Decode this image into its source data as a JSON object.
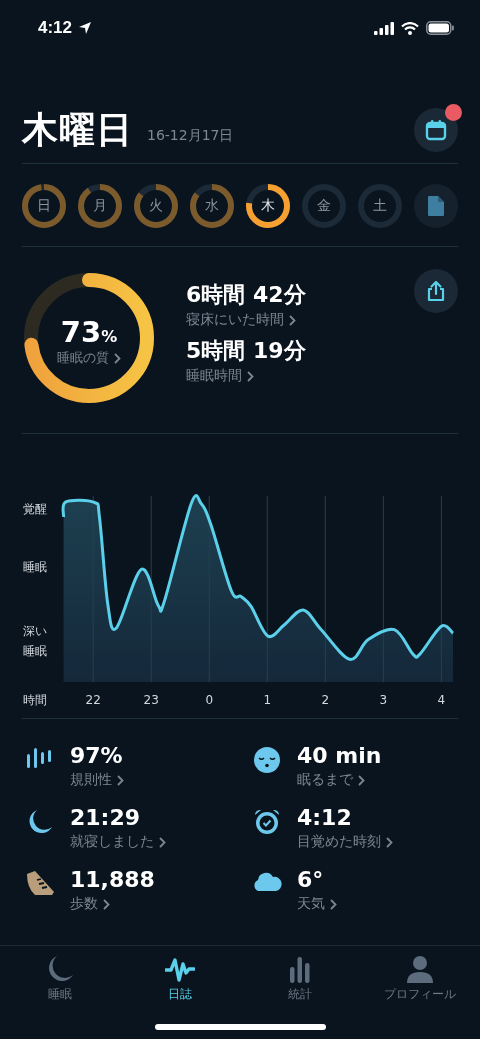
{
  "status_bar": {
    "time": "4:12"
  },
  "header": {
    "title": "木曜日",
    "subtitle": "16-12月17日",
    "calendar_badge": true
  },
  "days": [
    {
      "label": "日",
      "recorded": true,
      "selected": false,
      "kind": "day"
    },
    {
      "label": "月",
      "recorded": true,
      "selected": false,
      "kind": "day"
    },
    {
      "label": "火",
      "recorded": true,
      "selected": false,
      "kind": "day"
    },
    {
      "label": "水",
      "recorded": true,
      "selected": false,
      "kind": "day"
    },
    {
      "label": "木",
      "recorded": true,
      "selected": true,
      "kind": "day"
    },
    {
      "label": "金",
      "recorded": false,
      "selected": false,
      "kind": "day"
    },
    {
      "label": "土",
      "recorded": false,
      "selected": false,
      "kind": "day"
    },
    {
      "kind": "report"
    }
  ],
  "quality": {
    "value": "73",
    "unit": "%",
    "label": "睡眠の質",
    "level": 0.73
  },
  "durations": [
    {
      "value": "6時間 42分",
      "label": "寝床にいた時間"
    },
    {
      "value": "5時間 19分",
      "label": "睡眠時間"
    }
  ],
  "chart": {
    "axis_title": "時間",
    "stages": [
      "覚醒",
      "睡眠",
      "深い睡眠"
    ],
    "hours": [
      "22",
      "23",
      "0",
      "1",
      "2",
      "3",
      "4"
    ]
  },
  "stats": [
    {
      "kind": "bars",
      "value": "97%",
      "label": "規則性"
    },
    {
      "kind": "sleepy",
      "value": "40 min",
      "label": "眠るまで"
    },
    {
      "kind": "moon",
      "value": "21:29",
      "label": "就寝しました"
    },
    {
      "kind": "alarm",
      "value": "4:12",
      "label": "目覚めた時刻"
    },
    {
      "kind": "shoe",
      "value": "11,888",
      "label": "歩数"
    },
    {
      "kind": "cloud",
      "value": "6°",
      "label": "天気"
    }
  ],
  "tabs": [
    {
      "label": "睡眠",
      "kind": "moon",
      "selected": false
    },
    {
      "label": "日誌",
      "kind": "wave",
      "selected": true
    },
    {
      "label": "統計",
      "kind": "bars",
      "selected": false
    },
    {
      "label": "プロフィール",
      "kind": "person",
      "selected": false
    }
  ]
}
